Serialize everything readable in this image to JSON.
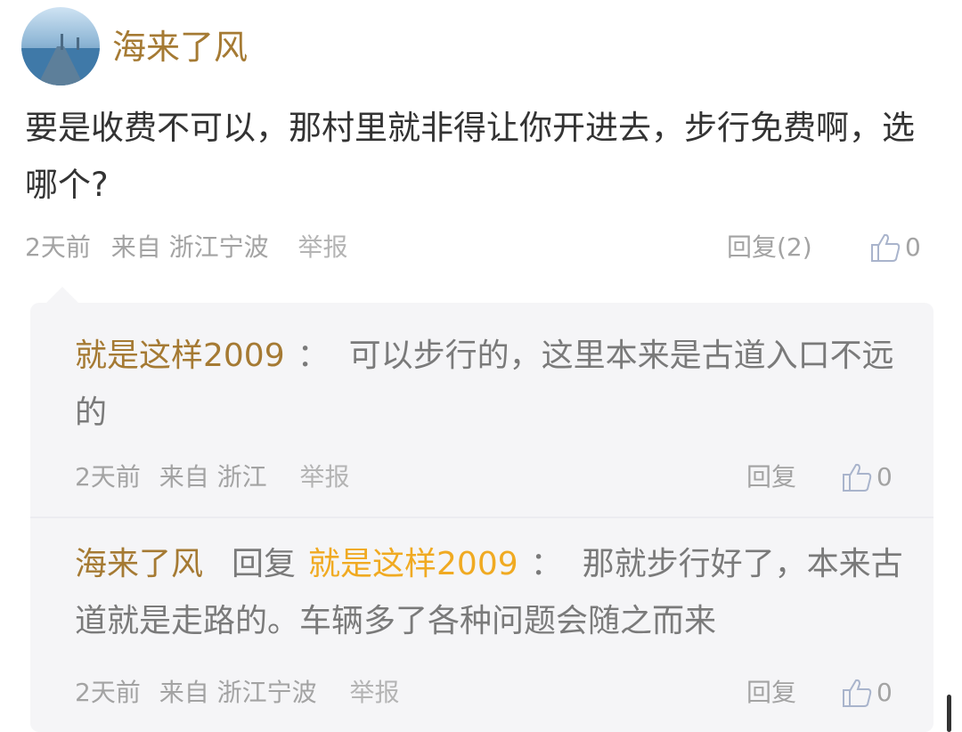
{
  "post": {
    "username": "海来了风",
    "text": "要是收费不可以，那村里就非得让你开进去，步行免费啊，选哪个?",
    "time": "2天前",
    "from": "来自 浙江宁波",
    "report": "举报",
    "reply": "回复(2)",
    "likes": "0"
  },
  "replies": [
    {
      "author": "就是这样2009",
      "colon": "：",
      "text": "可以步行的，这里本来是古道入口不远的",
      "time": "2天前",
      "from": "来自 浙江",
      "report": "举报",
      "reply": "回复",
      "likes": "0"
    },
    {
      "author": "海来了风",
      "reply_word": "回复",
      "reply_to": "就是这样2009",
      "colon": "：",
      "text": "那就步行好了，本来古道就是走路的。车辆多了各种问题会随之而来",
      "time": "2天前",
      "from": "来自 浙江宁波",
      "report": "举报",
      "reply": "回复",
      "likes": "0"
    }
  ],
  "icons": {
    "avatar": "pier-sea-avatar",
    "like": "thumbs-up-icon"
  },
  "colors": {
    "username": "#a57a33",
    "highlight_name": "#f0aa22",
    "meta": "#a3a3a3",
    "reply_bg": "#f5f5f7"
  }
}
